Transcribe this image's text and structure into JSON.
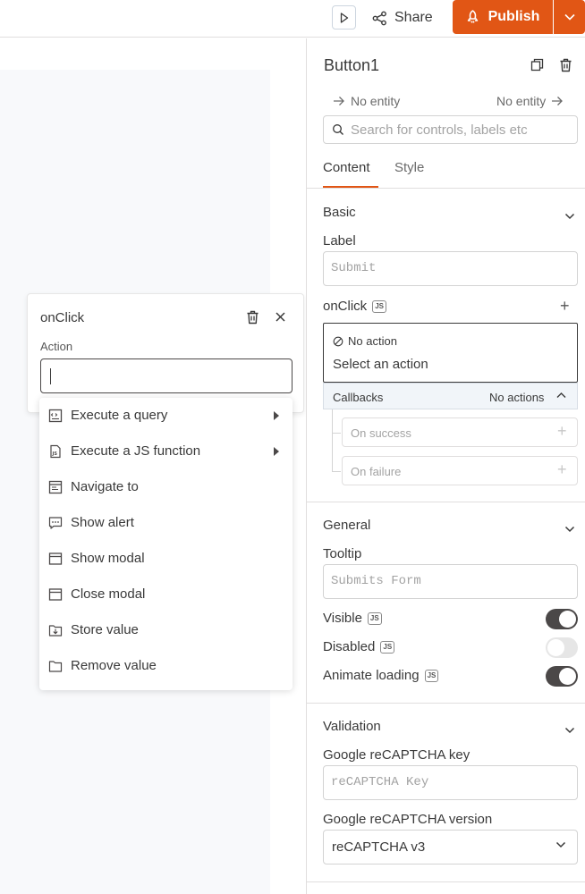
{
  "topbar": {
    "share_label": "Share",
    "publish_label": "Publish"
  },
  "action_popover": {
    "title": "onClick",
    "action_label": "Action",
    "input_value": ""
  },
  "action_menu": {
    "items": [
      {
        "label": "Execute a query",
        "icon": "query-icon",
        "has_submenu": true
      },
      {
        "label": "Execute a JS function",
        "icon": "js-file-icon",
        "has_submenu": true
      },
      {
        "label": "Navigate to",
        "icon": "navigate-icon",
        "has_submenu": false
      },
      {
        "label": "Show alert",
        "icon": "alert-icon",
        "has_submenu": false
      },
      {
        "label": "Show modal",
        "icon": "modal-icon",
        "has_submenu": false
      },
      {
        "label": "Close modal",
        "icon": "modal-icon",
        "has_submenu": false
      },
      {
        "label": "Store value",
        "icon": "store-icon",
        "has_submenu": false
      },
      {
        "label": "Remove value",
        "icon": "folder-icon",
        "has_submenu": false
      }
    ]
  },
  "panel": {
    "widget_name": "Button1",
    "entity_left": "No entity",
    "entity_right": "No entity",
    "search_placeholder": "Search for controls, labels etc",
    "tabs": {
      "content": "Content",
      "style": "Style"
    },
    "basic": {
      "title": "Basic",
      "label_field": "Label",
      "label_placeholder": "Submit",
      "onclick_label": "onClick",
      "js_badge": "JS",
      "no_action": "No action",
      "select_action": "Select an action",
      "callbacks_label": "Callbacks",
      "callbacks_value": "No actions",
      "on_success": "On success",
      "on_failure": "On failure"
    },
    "general": {
      "title": "General",
      "tooltip_label": "Tooltip",
      "tooltip_placeholder": "Submits Form",
      "visible_label": "Visible",
      "visible_on": true,
      "disabled_label": "Disabled",
      "disabled_on": false,
      "animate_label": "Animate loading",
      "animate_on": true
    },
    "validation": {
      "title": "Validation",
      "recaptcha_key_label": "Google reCAPTCHA key",
      "recaptcha_key_placeholder": "reCAPTCHA Key",
      "recaptcha_version_label": "Google reCAPTCHA version",
      "recaptcha_version_value": "reCAPTCHA v3"
    }
  },
  "colors": {
    "accent": "#e15615",
    "text": "#393939",
    "toggle_on": "#4b4848"
  }
}
